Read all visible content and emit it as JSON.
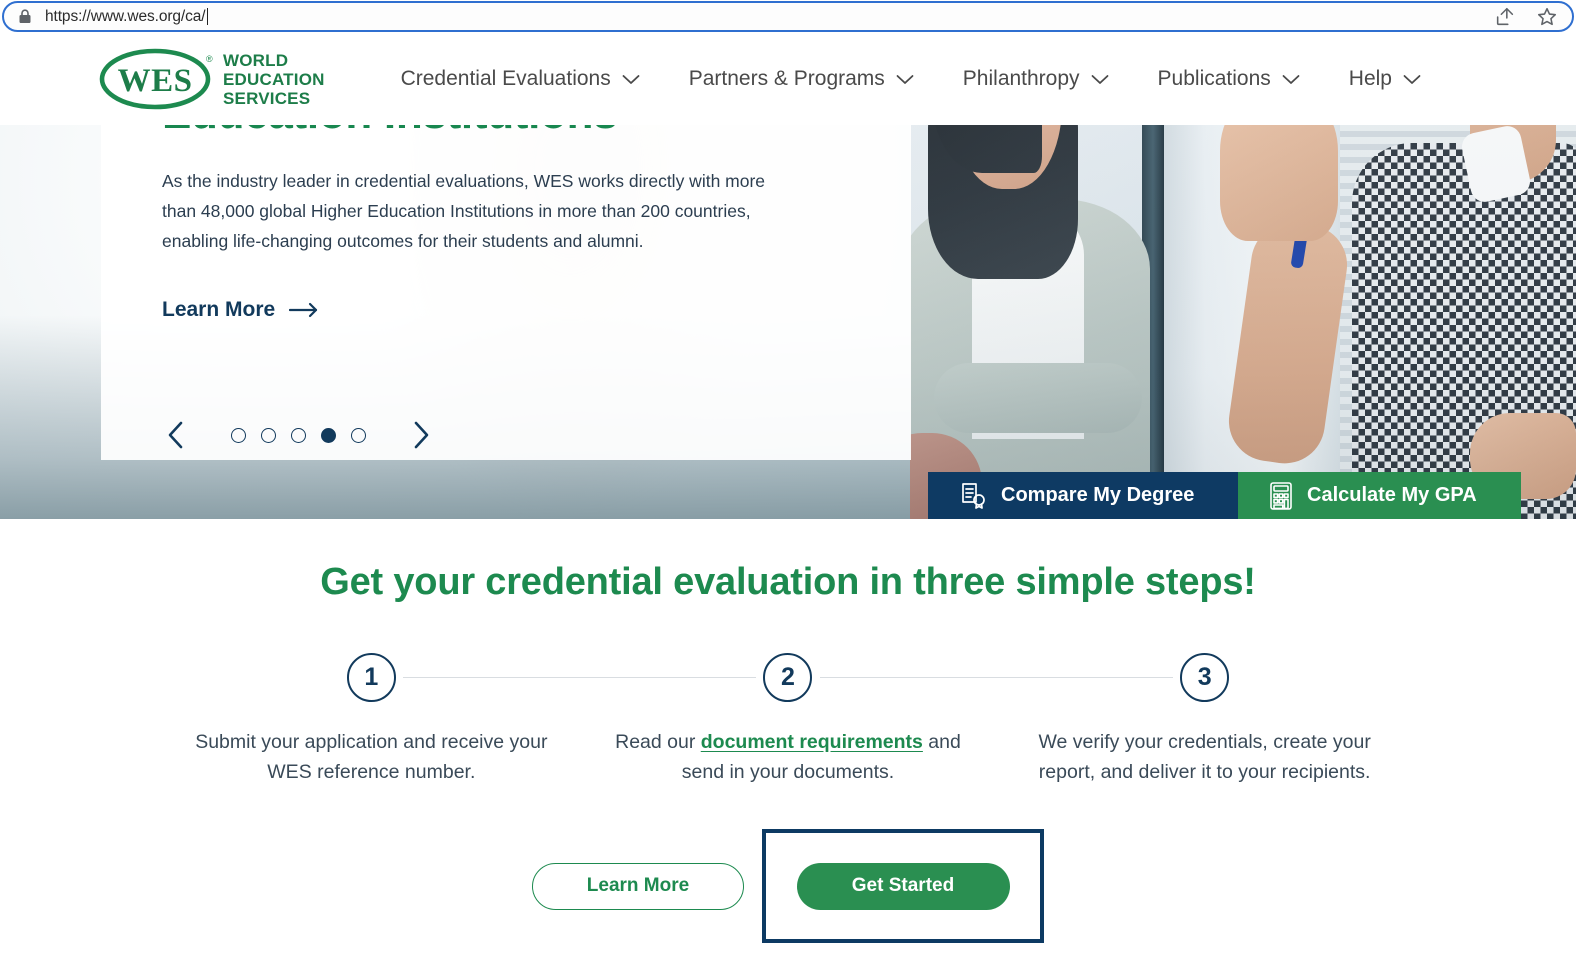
{
  "browser": {
    "url": "https://www.wes.org/ca/",
    "lock_icon": "lock-icon",
    "share_icon": "share-icon",
    "bookmark_icon": "star-icon"
  },
  "header": {
    "logo": {
      "mark": "wes-oval-logo",
      "line1": "WORLD",
      "line2": "EDUCATION",
      "line3": "SERVICES",
      "registered": "®"
    },
    "nav": [
      {
        "label": "Credential Evaluations",
        "caret": "chevron-down-icon"
      },
      {
        "label": "Partners & Programs",
        "caret": "chevron-down-icon"
      },
      {
        "label": "Philanthropy",
        "caret": "chevron-down-icon"
      },
      {
        "label": "Publications",
        "caret": "chevron-down-icon"
      },
      {
        "label": "Help",
        "caret": "chevron-down-icon"
      }
    ]
  },
  "hero": {
    "heading": "Education Institutions",
    "paragraph": "As the industry leader in credential evaluations, WES works directly with more than 48,000 global Higher Education Institutions in more than 200 countries, enabling life-changing outcomes for their students and alumni.",
    "learn_more": "Learn More",
    "learn_more_arrow": "arrow-right-icon",
    "carousel": {
      "prev_icon": "chevron-left-icon",
      "next_icon": "chevron-right-icon",
      "total_slides": 5,
      "active_slide": 4
    },
    "strips": [
      {
        "label": "Compare My Degree",
        "icon": "certificate-icon",
        "color": "#0e3a63"
      },
      {
        "label": "Calculate My GPA",
        "icon": "calculator-icon",
        "color": "#2a8f51"
      }
    ]
  },
  "steps_section": {
    "title": "Get your credential evaluation in three simple steps!",
    "steps": [
      {
        "number": "1",
        "text_before": "Submit your application and receive your WES reference number.",
        "link": "",
        "text_after": ""
      },
      {
        "number": "2",
        "text_before": "Read our ",
        "link": "document requirements",
        "text_after": " and send in your documents."
      },
      {
        "number": "3",
        "text_before": "We verify your credentials, create your report, and deliver it to your recipients.",
        "link": "",
        "text_after": ""
      }
    ],
    "buttons": {
      "learn_more": "Learn More",
      "get_started": "Get Started"
    }
  },
  "colors": {
    "brand_green": "#1d8a4f",
    "brand_navy": "#0d3a63",
    "strip_green": "#2a8f51",
    "highlight_border": "#0d3a63"
  }
}
